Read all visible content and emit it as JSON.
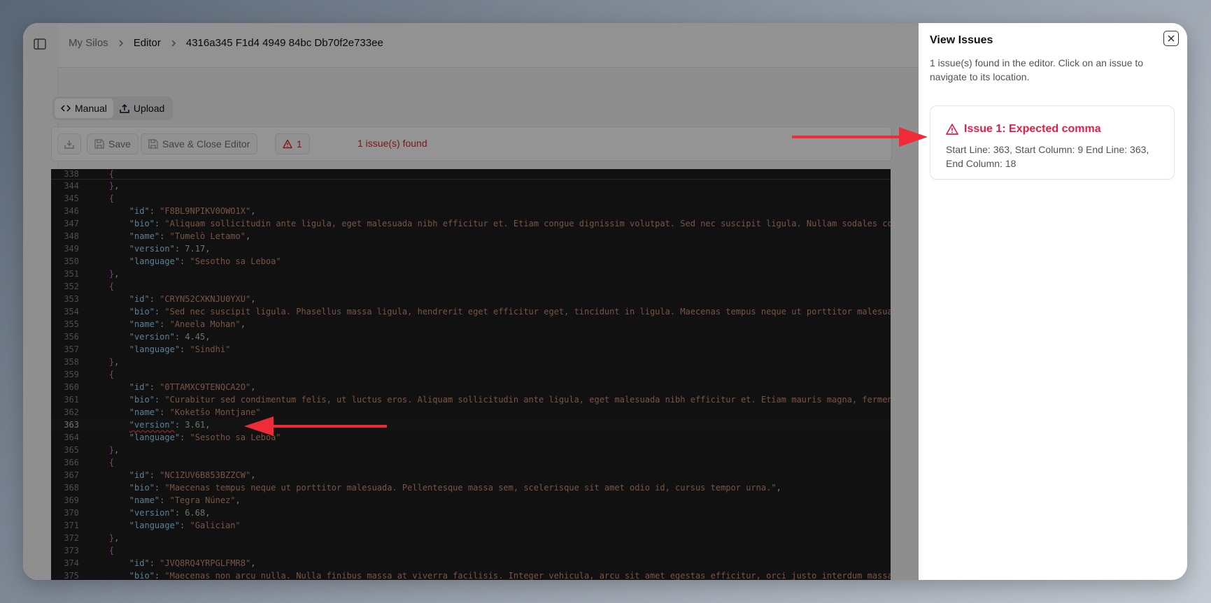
{
  "breadcrumb": {
    "items": [
      "My Silos",
      "Editor",
      "4316a345 F1d4 4949 84bc Db70f2e733ee"
    ]
  },
  "mode_tabs": {
    "manual": "Manual",
    "upload": "Upload"
  },
  "toolbar": {
    "save_label": "Save",
    "save_close_label": "Save & Close Editor",
    "issue_count": "1",
    "issues_found": "1 issue(s) found"
  },
  "editor": {
    "sticky_line_number": "338",
    "lines": [
      {
        "n": "344",
        "t": "close"
      },
      {
        "n": "345",
        "t": "open"
      },
      {
        "n": "346",
        "t": "kv",
        "key": "id",
        "val": "F8BL9NPIKV0OWO1X",
        "type": "s",
        "comma": true
      },
      {
        "n": "347",
        "t": "kv",
        "key": "bio",
        "val": "Aliquam sollicitudin ante ligula, eget malesuada nibh efficitur et. Etiam congue dignissim volutpat. Sed nec suscipit ligula. Nullam sodales conval",
        "type": "s",
        "comma": false,
        "noclose": true
      },
      {
        "n": "348",
        "t": "kv",
        "key": "name",
        "val": "Tumelò Letamo",
        "type": "s",
        "comma": true
      },
      {
        "n": "349",
        "t": "kv",
        "key": "version",
        "val": "7.17",
        "type": "n",
        "comma": true
      },
      {
        "n": "350",
        "t": "kv",
        "key": "language",
        "val": "Sesotho sa Leboa",
        "type": "s",
        "comma": false
      },
      {
        "n": "351",
        "t": "close"
      },
      {
        "n": "352",
        "t": "open"
      },
      {
        "n": "353",
        "t": "kv",
        "key": "id",
        "val": "CRYN52CXKNJU0YXU",
        "type": "s",
        "comma": true
      },
      {
        "n": "354",
        "t": "kv",
        "key": "bio",
        "val": "Sed nec suscipit ligula. Phasellus massa ligula, hendrerit eget efficitur eget, tincidunt in ligula. Maecenas tempus neque ut porttitor malesuada.",
        "type": "s",
        "comma": true
      },
      {
        "n": "355",
        "t": "kv",
        "key": "name",
        "val": "Aneela Mohan",
        "type": "s",
        "comma": true
      },
      {
        "n": "356",
        "t": "kv",
        "key": "version",
        "val": "4.45",
        "type": "n",
        "comma": true
      },
      {
        "n": "357",
        "t": "kv",
        "key": "language",
        "val": "Sindhi",
        "type": "s",
        "comma": false
      },
      {
        "n": "358",
        "t": "close"
      },
      {
        "n": "359",
        "t": "open"
      },
      {
        "n": "360",
        "t": "kv",
        "key": "id",
        "val": "0TTAMXC9TENQCA2O",
        "type": "s",
        "comma": true
      },
      {
        "n": "361",
        "t": "kv",
        "key": "bio",
        "val": "Curabitur sed condimentum felis, ut luctus eros. Aliquam sollicitudin ante ligula, eget malesuada nibh efficitur et. Etiam mauris magna, fermentum",
        "type": "s",
        "comma": false,
        "noclose": true
      },
      {
        "n": "362",
        "t": "kv",
        "key": "name",
        "val": "Koketšo Montjane",
        "type": "s",
        "comma": false
      },
      {
        "n": "363",
        "t": "kv",
        "key": "version",
        "val": "3.61",
        "type": "n",
        "comma": true,
        "error": true,
        "current": true
      },
      {
        "n": "364",
        "t": "kv",
        "key": "language",
        "val": "Sesotho sa Leboa",
        "type": "s",
        "comma": false
      },
      {
        "n": "365",
        "t": "close"
      },
      {
        "n": "366",
        "t": "open"
      },
      {
        "n": "367",
        "t": "kv",
        "key": "id",
        "val": "NC1ZUV6B853BZZCW",
        "type": "s",
        "comma": true
      },
      {
        "n": "368",
        "t": "kv",
        "key": "bio",
        "val": "Maecenas tempus neque ut porttitor malesuada. Pellentesque massa sem, scelerisque sit amet odio id, cursus tempor urna.",
        "type": "s",
        "comma": true
      },
      {
        "n": "369",
        "t": "kv",
        "key": "name",
        "val": "Tegra Núnez",
        "type": "s",
        "comma": true
      },
      {
        "n": "370",
        "t": "kv",
        "key": "version",
        "val": "6.68",
        "type": "n",
        "comma": true
      },
      {
        "n": "371",
        "t": "kv",
        "key": "language",
        "val": "Galician",
        "type": "s",
        "comma": false
      },
      {
        "n": "372",
        "t": "close"
      },
      {
        "n": "373",
        "t": "open"
      },
      {
        "n": "374",
        "t": "kv",
        "key": "id",
        "val": "JVQ8RQ4YRPGLFMR8",
        "type": "s",
        "comma": true
      },
      {
        "n": "375",
        "t": "kv",
        "key": "bio",
        "val": "Maecenas non arcu nulla. Nulla finibus massa at viverra facilisis. Integer vehicula, arcu sit amet egestas efficitur, orci justo interdum massa, eg",
        "type": "s",
        "comma": false,
        "noclose": true
      }
    ]
  },
  "issues_panel": {
    "title": "View Issues",
    "description": "1 issue(s) found in the editor. Click on an issue to navigate to its location.",
    "issues": [
      {
        "title": "Issue 1: Expected comma",
        "detail": "Start Line: 363, Start Column: 9 End Line: 363, End Column: 18"
      }
    ]
  },
  "colors": {
    "error": "#e11d48",
    "annotation_arrow": "#ee2b37"
  }
}
